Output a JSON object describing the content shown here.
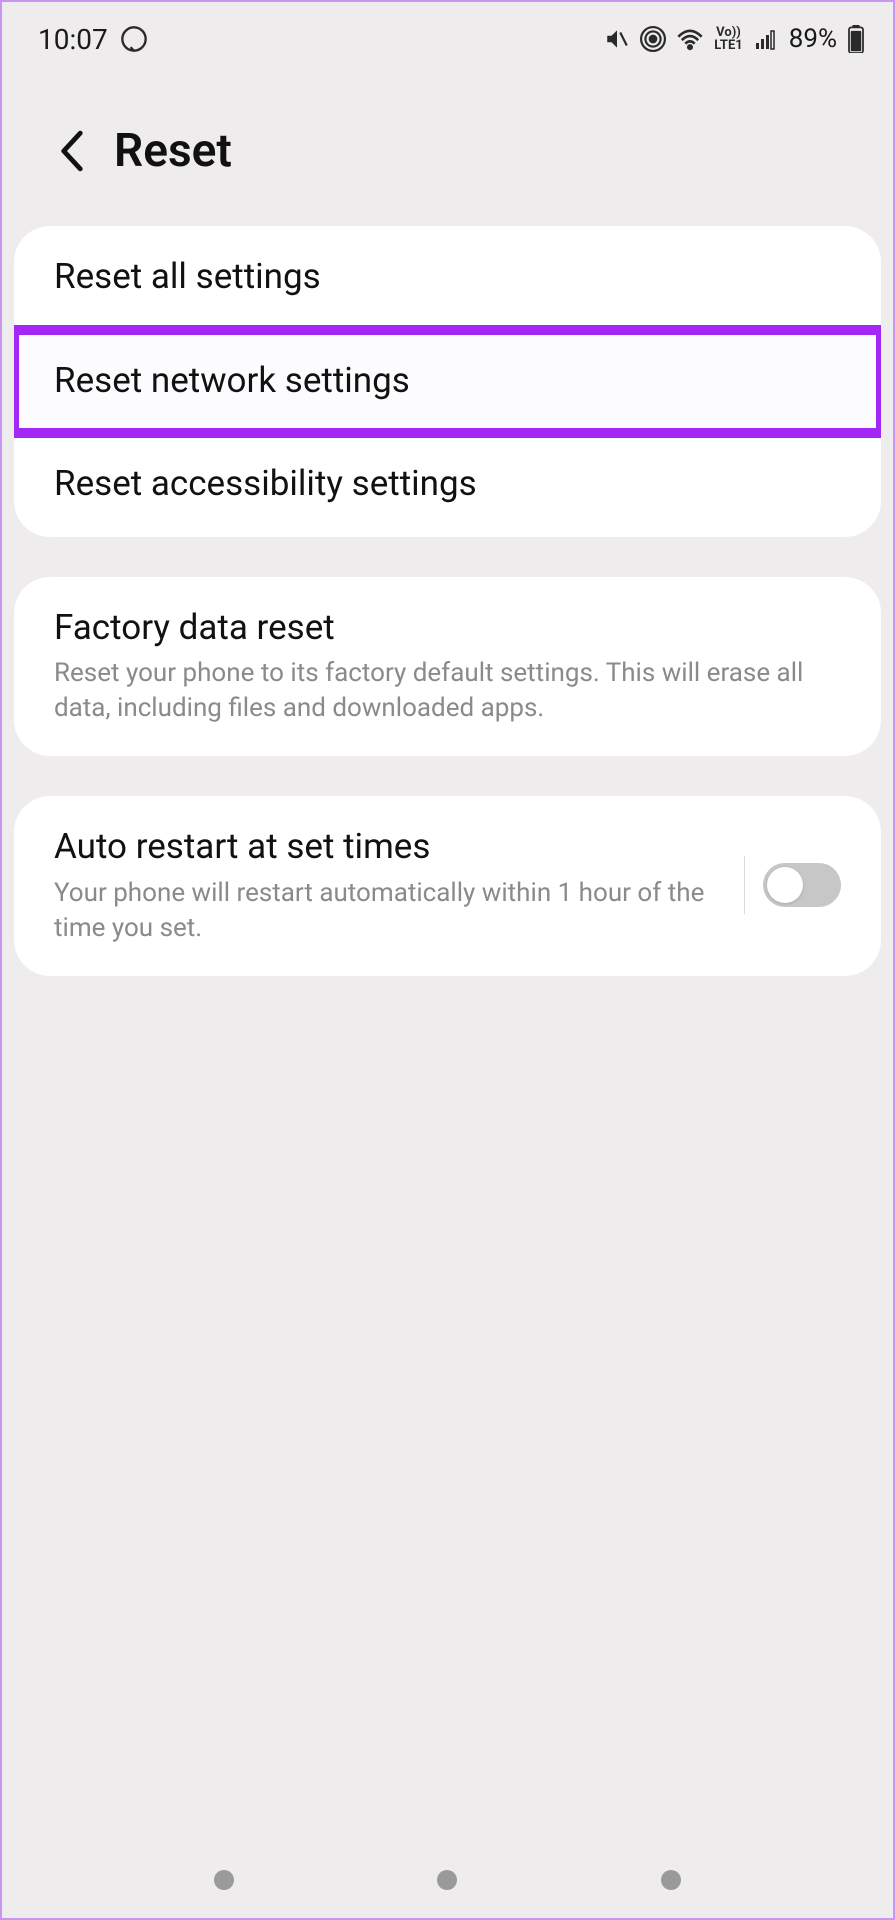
{
  "status": {
    "time": "10:07",
    "battery": "89%"
  },
  "header": {
    "title": "Reset"
  },
  "group1": {
    "items": [
      {
        "label": "Reset all settings"
      },
      {
        "label": "Reset network settings"
      },
      {
        "label": "Reset accessibility settings"
      }
    ]
  },
  "group2": {
    "title": "Factory data reset",
    "subtitle": "Reset your phone to its factory default settings. This will erase all data, including files and downloaded apps."
  },
  "group3": {
    "title": "Auto restart at set times",
    "subtitle": "Your phone will restart automatically within 1 hour of the time you set.",
    "toggle": false
  },
  "volte": {
    "top": "Vo))",
    "bottom": "LTE1"
  }
}
